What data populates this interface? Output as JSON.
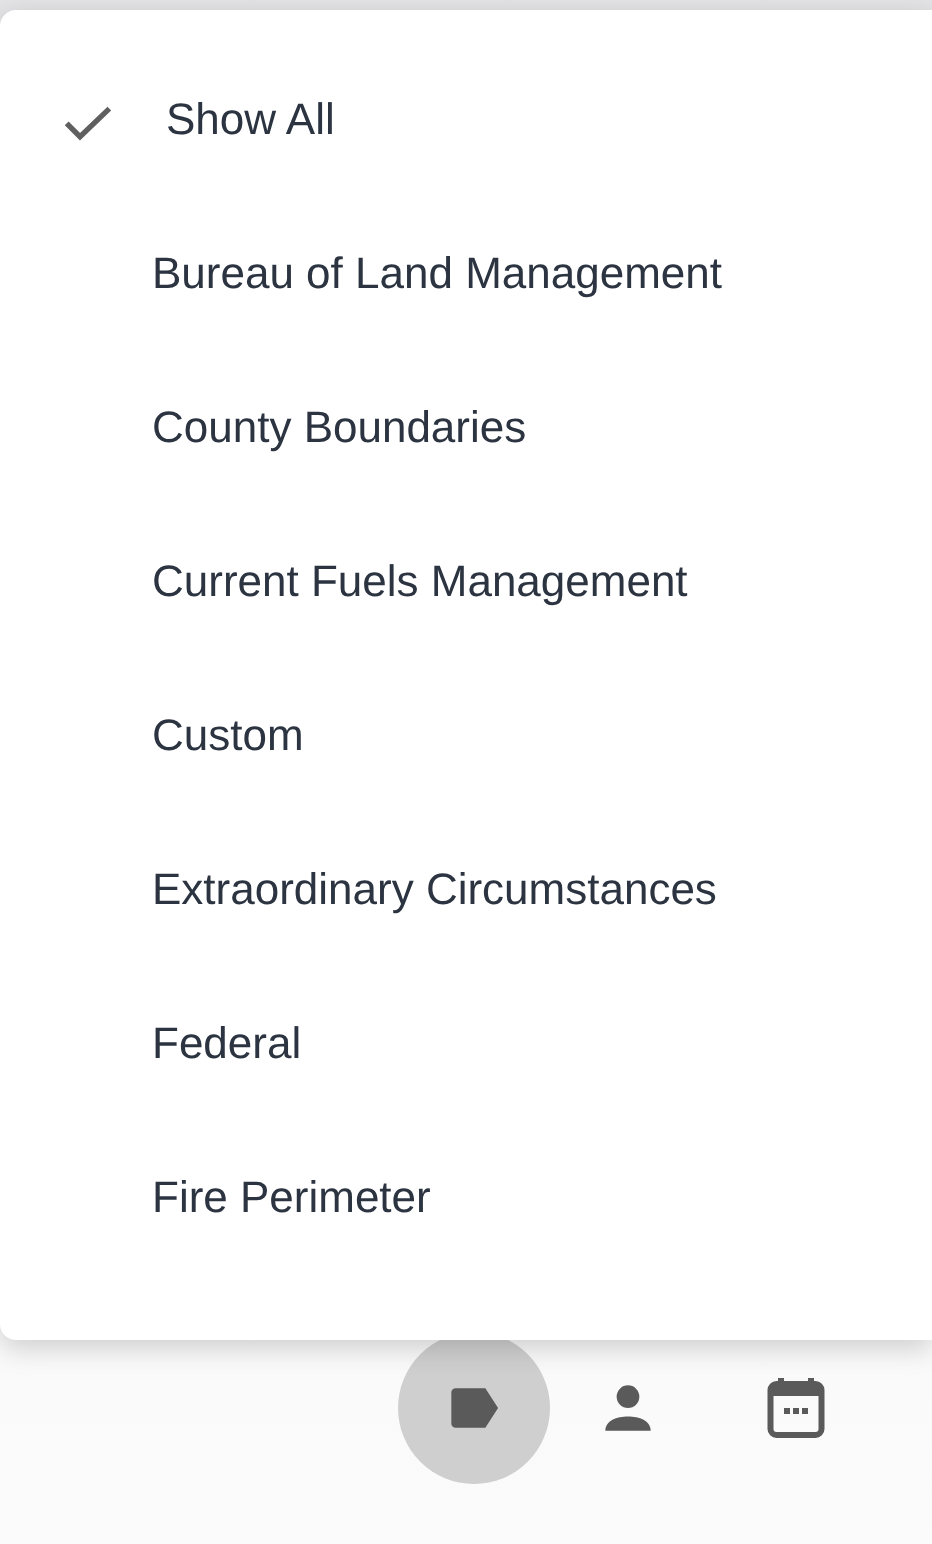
{
  "menu": {
    "items": [
      {
        "label": "Show All",
        "checked": true
      },
      {
        "label": "Bureau of Land Management",
        "checked": false
      },
      {
        "label": "County Boundaries",
        "checked": false
      },
      {
        "label": "Current Fuels Management",
        "checked": false
      },
      {
        "label": "Custom",
        "checked": false
      },
      {
        "label": "Extraordinary Circumstances",
        "checked": false
      },
      {
        "label": "Federal",
        "checked": false
      },
      {
        "label": "Fire Perimeter",
        "checked": false
      }
    ]
  },
  "toolbar": {
    "buttons": [
      {
        "kind": "tag",
        "selected": true
      },
      {
        "kind": "person",
        "selected": false
      },
      {
        "kind": "calendar",
        "selected": false
      }
    ]
  }
}
